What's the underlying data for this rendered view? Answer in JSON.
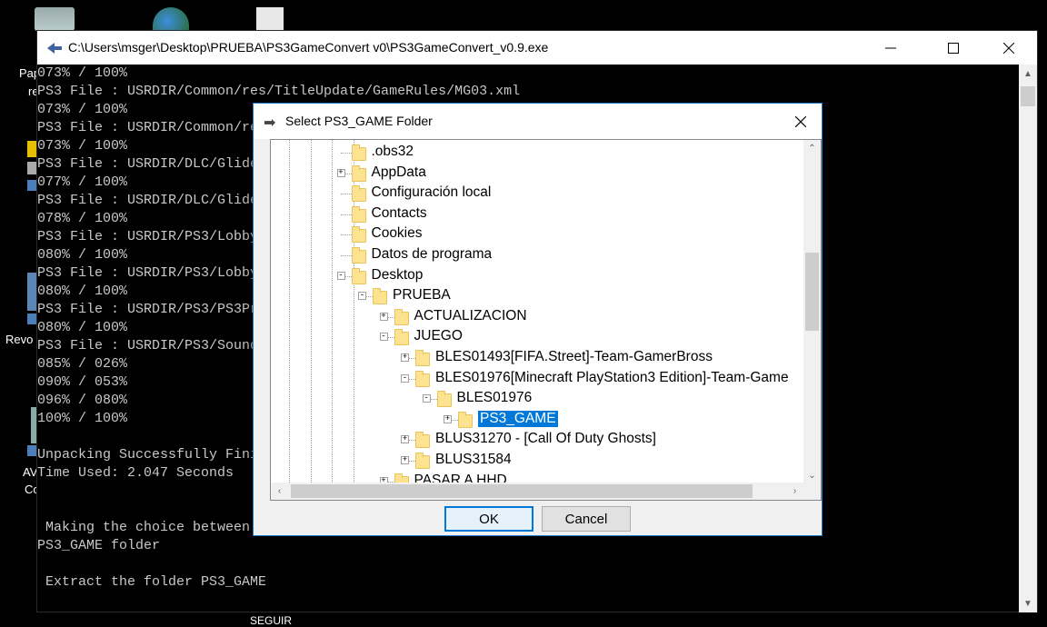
{
  "console": {
    "title": "C:\\Users\\msger\\Desktop\\PRUEBA\\PS3GameConvert v0\\PS3GameConvert_v0.9.exe",
    "lines": [
      "073% / 100%",
      "PS3 File : USRDIR/Common/res/TitleUpdate/GameRules/MG03.xml",
      "073% / 100%",
      "PS3 File : USRDIR/Common/re",
      "073% / 100%",
      "PS3 File : USRDIR/DLC/Glide",
      "077% / 100%",
      "PS3 File : USRDIR/DLC/Glide",
      "078% / 100%",
      "PS3 File : USRDIR/PS3/Lobby",
      "080% / 100%",
      "PS3 File : USRDIR/PS3/Lobby",
      "080% / 100%",
      "PS3 File : USRDIR/PS3/PS3Pr",
      "080% / 100%",
      "PS3 File : USRDIR/PS3/Sound",
      "085% / 026%",
      "090% / 053%",
      "096% / 080%",
      "100% / 100%",
      "",
      "Unpacking Successfully Fini",
      "Time Used: 2.047 Seconds",
      "",
      "",
      " Making the choice between",
      "PS3_GAME folder",
      "",
      " Extract the folder PS3_GAME"
    ]
  },
  "desktop": {
    "labels": [
      "Pap",
      "re",
      "Revo",
      "AV",
      "Co"
    ],
    "bottom_label": "SEGUIR"
  },
  "dialog": {
    "title": "Select PS3_GAME Folder",
    "ok_label": "OK",
    "cancel_label": "Cancel",
    "tree": [
      {
        "label": ".obs32",
        "expander": ""
      },
      {
        "label": "AppData",
        "expander": "+"
      },
      {
        "label": "Configuración local",
        "expander": ""
      },
      {
        "label": "Contacts",
        "expander": ""
      },
      {
        "label": "Cookies",
        "expander": ""
      },
      {
        "label": "Datos de programa",
        "expander": ""
      },
      {
        "label": "Desktop",
        "expander": "−"
      },
      {
        "label": "PRUEBA",
        "expander": "−"
      },
      {
        "label": "ACTUALIZACION",
        "expander": "+"
      },
      {
        "label": "JUEGO",
        "expander": "−"
      },
      {
        "label": "BLES01493[FIFA.Street]-Team-GamerBross",
        "expander": "+"
      },
      {
        "label": "BLES01976[Minecraft PlayStation3 Edition]-Team-Game",
        "expander": "−"
      },
      {
        "label": "BLES01976",
        "expander": "−"
      },
      {
        "label": "PS3_GAME",
        "expander": "+",
        "selected": true
      },
      {
        "label": "BLUS31270 - [Call Of Duty Ghosts]",
        "expander": "+"
      },
      {
        "label": "BLUS31584",
        "expander": "+"
      },
      {
        "label": "PASAR A HHD",
        "expander": "+"
      }
    ]
  }
}
